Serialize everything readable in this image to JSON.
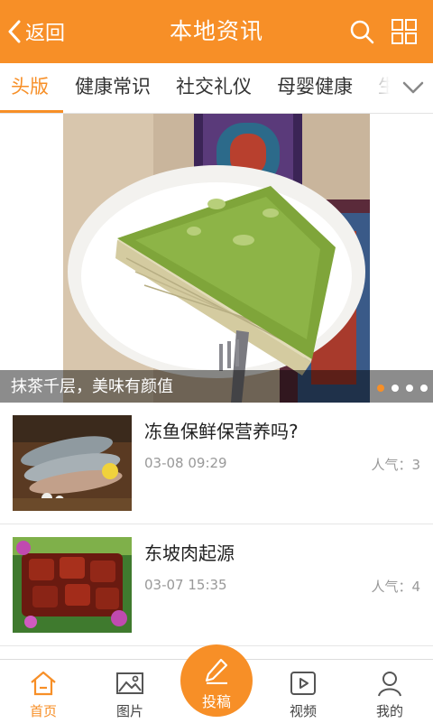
{
  "header": {
    "back_label": "返回",
    "title": "本地资讯"
  },
  "tabs": [
    {
      "label": "头版",
      "active": true
    },
    {
      "label": "健康常识"
    },
    {
      "label": "社交礼仪"
    },
    {
      "label": "母婴健康"
    },
    {
      "label": "生活"
    }
  ],
  "banner": {
    "caption": "抹茶千层，美味有颜值",
    "slides_total": 4,
    "current_slide": 1
  },
  "news": [
    {
      "title": "冻鱼保鲜保营养吗?",
      "time": "03-08 09:29",
      "popularity": "人气：3"
    },
    {
      "title": "东坡肉起源",
      "time": "03-07 15:35",
      "popularity": "人气：4"
    }
  ],
  "tabbar": {
    "home": "首页",
    "pictures": "图片",
    "post": "投稿",
    "video": "视频",
    "mine": "我的"
  },
  "colors": {
    "accent": "#f78f27"
  }
}
